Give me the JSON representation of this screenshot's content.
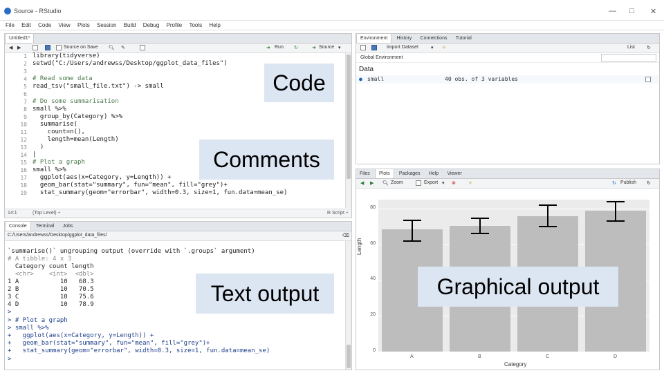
{
  "window": {
    "title": "Source - RStudio",
    "buttons": [
      "—",
      "□",
      "✕"
    ]
  },
  "menu": [
    "File",
    "Edit",
    "Code",
    "View",
    "Plots",
    "Session",
    "Build",
    "Debug",
    "Profile",
    "Tools",
    "Help"
  ],
  "source_pane": {
    "tab": "Untitled1*",
    "toolbar": {
      "source_on_save": "Source on Save",
      "run": "Run",
      "source": "Source"
    },
    "lines": [
      {
        "n": "1",
        "text": "library(tidyverse)",
        "type": "code"
      },
      {
        "n": "2",
        "text": "setwd(\"C:/Users/andrewss/Desktop/ggplot_data_files\")",
        "type": "code"
      },
      {
        "n": "3",
        "text": "",
        "type": "code"
      },
      {
        "n": "4",
        "text": "# Read some data",
        "type": "comment"
      },
      {
        "n": "5",
        "text": "read_tsv(\"small_file.txt\") -> small",
        "type": "code"
      },
      {
        "n": "6",
        "text": "",
        "type": "code"
      },
      {
        "n": "7",
        "text": "# Do some summarisation",
        "type": "comment"
      },
      {
        "n": "8",
        "text": "small %>%",
        "type": "code"
      },
      {
        "n": "9",
        "text": "  group_by(Category) %>%",
        "type": "code"
      },
      {
        "n": "10",
        "text": "  summarise(",
        "type": "code"
      },
      {
        "n": "11",
        "text": "    count=n(),",
        "type": "code"
      },
      {
        "n": "12",
        "text": "    length=mean(Length)",
        "type": "code"
      },
      {
        "n": "13",
        "text": "  )",
        "type": "code"
      },
      {
        "n": "14",
        "text": "|",
        "type": "code"
      },
      {
        "n": "15",
        "text": "# Plot a graph",
        "type": "comment"
      },
      {
        "n": "16",
        "text": "small %>%",
        "type": "code"
      },
      {
        "n": "17",
        "text": "  ggplot(aes(x=Category, y=Length)) +",
        "type": "code"
      },
      {
        "n": "18",
        "text": "  geom_bar(stat=\"summary\", fun=\"mean\", fill=\"grey\")+",
        "type": "code"
      },
      {
        "n": "19",
        "text": "  stat_summary(geom=\"errorbar\", width=0.3, size=1, fun.data=mean_se)",
        "type": "code"
      }
    ],
    "status_left": "14:1",
    "status_mid": "(Top Level) ÷",
    "status_right": "R Script ÷"
  },
  "console_pane": {
    "tabs": [
      "Console",
      "Terminal",
      "Jobs"
    ],
    "path": "C:/Users/andrewss/Desktop/ggplot_data_files/",
    "lines": [
      {
        "text": "`summarise()` ungrouping output (override with `.groups` argument)",
        "type": "out"
      },
      {
        "text": "# A tibble: 4 x 3",
        "type": "type"
      },
      {
        "text": "  Category count length",
        "type": "out"
      },
      {
        "text": "  <chr>    <int>  <dbl>",
        "type": "type"
      },
      {
        "text": "1 A           10   68.3",
        "type": "out"
      },
      {
        "text": "2 B           10   70.5",
        "type": "out"
      },
      {
        "text": "3 C           10   75.6",
        "type": "out"
      },
      {
        "text": "4 D           10   78.9",
        "type": "out"
      },
      {
        "text": ">",
        "type": "prompt"
      },
      {
        "text": "> # Plot a graph",
        "type": "prompt"
      },
      {
        "text": "> small %>%",
        "type": "prompt"
      },
      {
        "text": "+   ggplot(aes(x=Category, y=Length)) +",
        "type": "prompt"
      },
      {
        "text": "+   geom_bar(stat=\"summary\", fun=\"mean\", fill=\"grey\")+",
        "type": "prompt"
      },
      {
        "text": "+   stat_summary(geom=\"errorbar\", width=0.3, size=1, fun.data=mean_se)",
        "type": "prompt"
      },
      {
        "text": ">",
        "type": "prompt"
      }
    ]
  },
  "environment_pane": {
    "tabs": [
      "Environment",
      "History",
      "Connections",
      "Tutorial"
    ],
    "import_dataset": "Import Dataset",
    "list_view": "List",
    "scope": "Global Environment",
    "section": "Data",
    "items": [
      {
        "name": "small",
        "desc": "40 obs. of 3 variables"
      }
    ]
  },
  "plots_pane": {
    "tabs": [
      "Files",
      "Plots",
      "Packages",
      "Help",
      "Viewer"
    ],
    "zoom": "Zoom",
    "export": "Export",
    "publish": "Publish"
  },
  "labels": {
    "code": "Code",
    "comments": "Comments",
    "text_output": "Text output",
    "graphical_output": "Graphical output"
  },
  "chart_data": {
    "type": "bar",
    "categories": [
      "A",
      "B",
      "C",
      "D"
    ],
    "values": [
      68.3,
      70.5,
      75.6,
      78.9
    ],
    "error_low": [
      62,
      66,
      70,
      73
    ],
    "error_high": [
      73.5,
      74.5,
      82,
      84
    ],
    "xlabel": "Category",
    "ylabel": "Length",
    "ylim": [
      0,
      85
    ],
    "yticks": [
      0,
      20,
      40,
      60,
      80
    ],
    "grid": true,
    "bar_color": "#bdbdbd",
    "panel_color": "#ebebeb"
  }
}
